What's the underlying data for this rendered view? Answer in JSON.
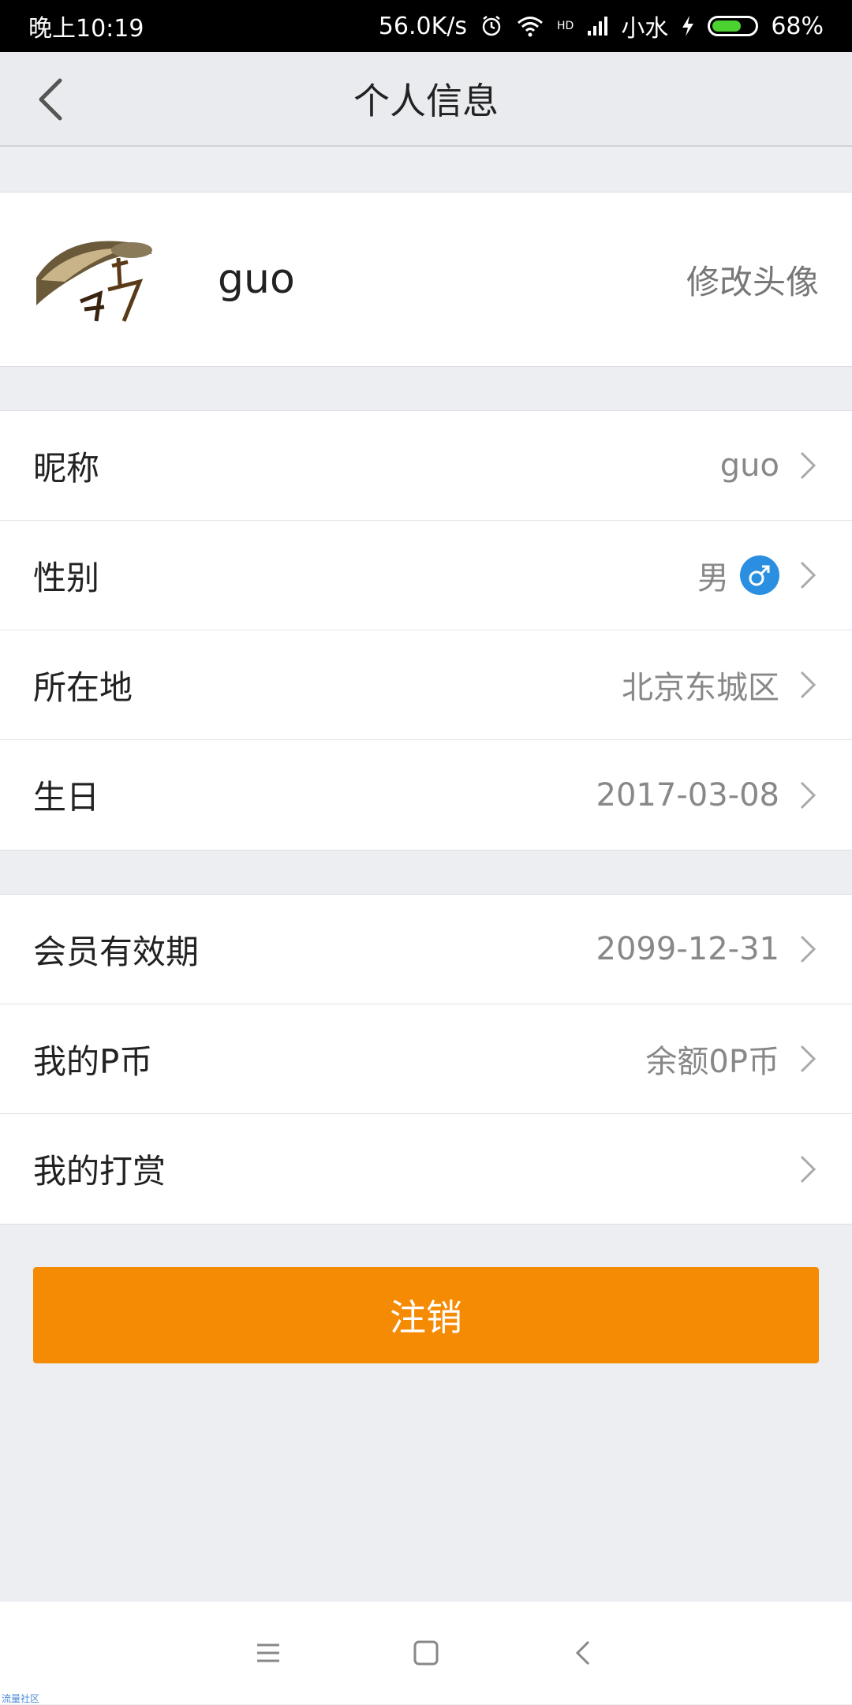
{
  "status_bar": {
    "time": "晚上10:19",
    "speed": "56.0K/s",
    "carrier": "小水",
    "battery": "68%",
    "battery_level": 0.68,
    "hd_label": "HD"
  },
  "header": {
    "title": "个人信息",
    "back_icon": "chevron-left-icon"
  },
  "profile": {
    "username": "guo",
    "change_avatar": "修改头像"
  },
  "info_rows": [
    {
      "label": "昵称",
      "value": "guo"
    },
    {
      "label": "性别",
      "value": "男"
    },
    {
      "label": "所在地",
      "value": "北京东城区"
    },
    {
      "label": "生日",
      "value": "2017-03-08"
    }
  ],
  "account_rows": [
    {
      "label": "会员有效期",
      "value": "2099-12-31"
    },
    {
      "label": "我的P币",
      "value": "余额0P币"
    },
    {
      "label": "我的打赏",
      "value": ""
    }
  ],
  "logout": {
    "label": "注销"
  },
  "system_nav": {
    "menu_icon": "menu-icon",
    "home_icon": "home-icon",
    "back_icon": "back-icon"
  },
  "watermark": "流量社区",
  "colors": {
    "accent": "#f58a03",
    "gender_male": "#2a8fe0"
  }
}
